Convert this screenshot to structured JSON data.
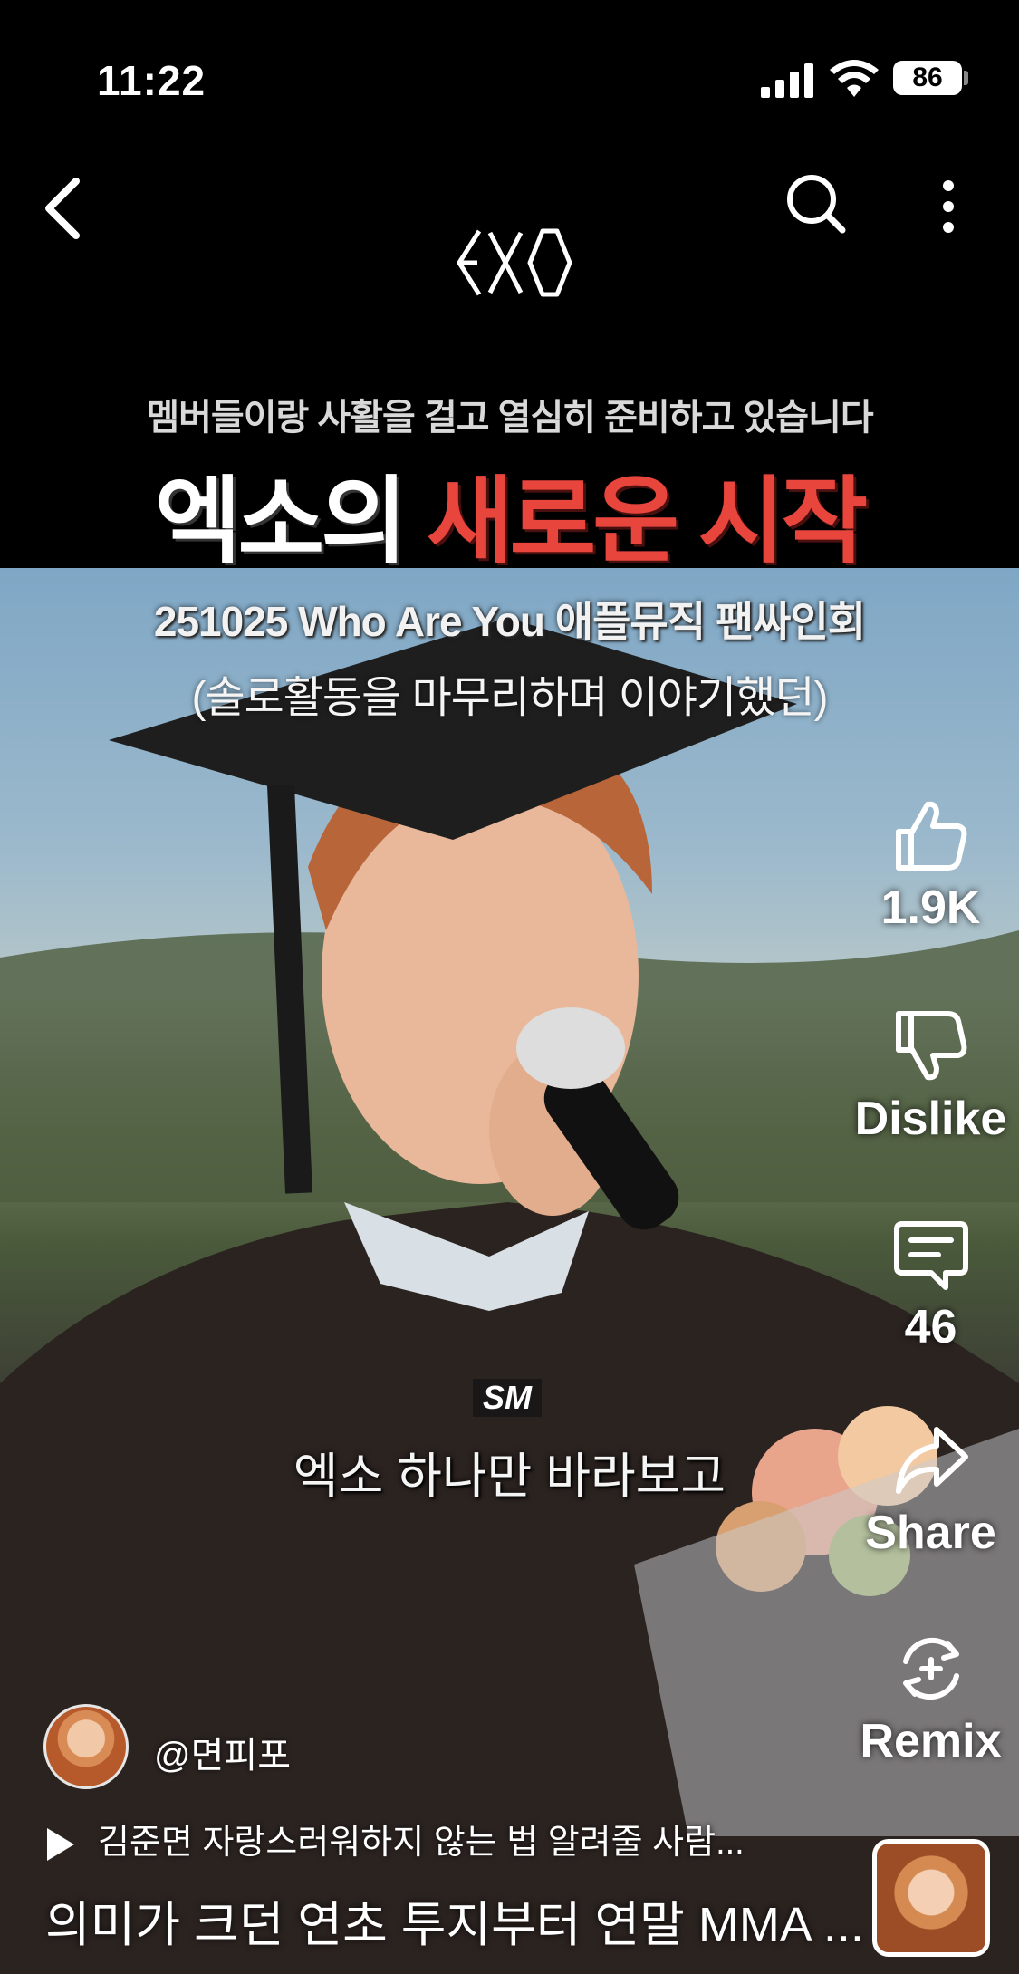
{
  "status_bar": {
    "time": "11:22",
    "battery": "86"
  },
  "overlay": {
    "logo": "EXO",
    "subtitle": "멤버들이랑 사활을 걸고 열심히 준비하고 있습니다",
    "headline_white": "엑소의",
    "headline_red": "새로운 시작",
    "date_line": "251025 Who Are You 애플뮤직 팬싸인회",
    "paren_line": "(솔로활동을 마무리하며 이야기했던)",
    "sm_logo": "SM",
    "bottom_caption": "엑소 하나만 바라보고"
  },
  "actions": {
    "like_count": "1.9K",
    "dislike_label": "Dislike",
    "comment_count": "46",
    "share_label": "Share",
    "remix_label": "Remix"
  },
  "channel": {
    "name": "@면피포"
  },
  "playlist": {
    "text": "김준면 자랑스러워하지 않는 법 알려줄 사람..."
  },
  "video": {
    "title": "의미가 크던 연초 투지부터 연말 MMA ..."
  },
  "colors": {
    "headline_red": "#e8453c",
    "background": "#000000"
  }
}
